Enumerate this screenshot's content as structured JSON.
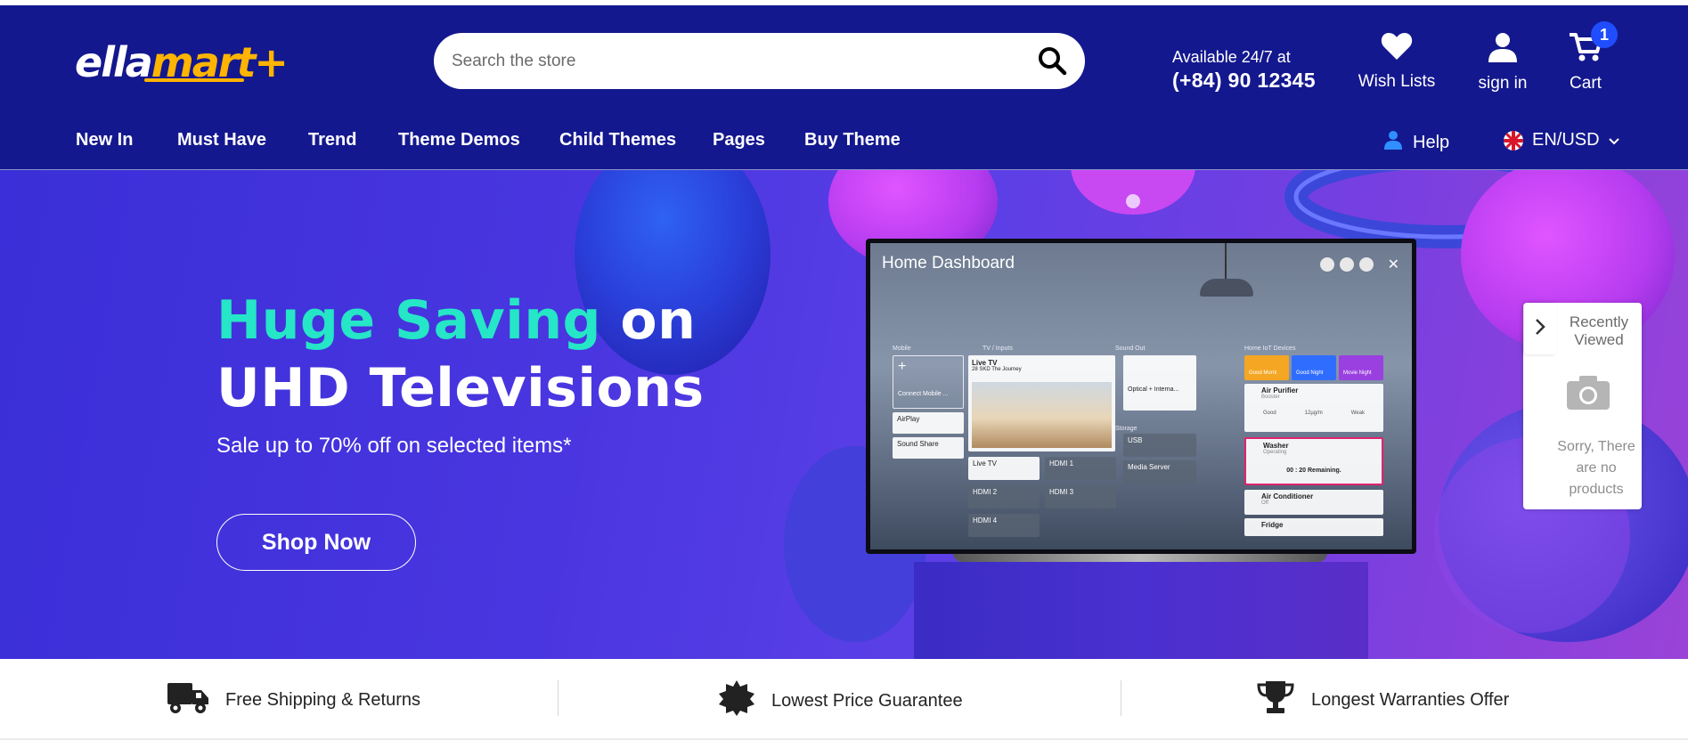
{
  "brand": {
    "logo_main": "ella",
    "logo_accent": "mart+",
    "accent_color": "#ffb400",
    "header_bg": "#14188e"
  },
  "search": {
    "placeholder": "Search the store",
    "icon": "search-icon"
  },
  "support": {
    "line1": "Available 24/7 at",
    "phone": "(+84) 90 12345"
  },
  "actions": {
    "wishlist": {
      "label": "Wish Lists",
      "icon": "heart-icon"
    },
    "signin": {
      "label": "sign in",
      "icon": "user-icon"
    },
    "cart": {
      "label": "Cart",
      "icon": "cart-icon",
      "count": "1"
    }
  },
  "nav": {
    "items": [
      "New In",
      "Must Have",
      "Trend",
      "Theme Demos",
      "Child Themes",
      "Pages",
      "Buy Theme"
    ],
    "help": "Help",
    "lang": "EN/USD"
  },
  "hero": {
    "title_highlight": "Huge Saving",
    "title_rest1": " on",
    "title_line2": "UHD Televisions",
    "subtitle": "Sale up to 70% off on selected items*",
    "cta": "Shop Now",
    "highlight_color": "#25e6c6"
  },
  "tv": {
    "dashboard_title": "Home Dashboard",
    "sections": {
      "mobile": "Mobile",
      "tv_inputs": "TV / Inputs",
      "sound_out": "Sound Out",
      "home_iot": "Home IoT Devices",
      "storage": "Storage"
    },
    "tiles": {
      "connect_mobile": "Connect Mobile ...",
      "airplay": "AirPlay",
      "sound_share": "Sound Share",
      "live_tv": "Live TV",
      "channel": "28 SKD",
      "program": "The Journey",
      "live_tv_2": "Live TV",
      "hdmi1": "HDMI 1",
      "hdmi2": "HDMI 2",
      "hdmi3": "HDMI 3",
      "hdmi4": "HDMI 4",
      "optical": "Optical + Interna...",
      "usb": "USB",
      "media_server": "Media Server",
      "good_morning": "Good Morni",
      "good_night": "Good Night",
      "movie_night": "Movie Night",
      "air_purifier": "Air Purifier",
      "air_purifier_status": "Booster",
      "aq_good": "Good",
      "aq_value": "12µg/m",
      "aq_weak": "Weak",
      "washer": "Washer",
      "washer_status": "Operating",
      "washer_time": "00 : 20 Remaining.",
      "air_conditioner": "Air Conditioner",
      "ac_status": "Off",
      "fridge": "Fridge"
    }
  },
  "recently_viewed": {
    "title": "Recently Viewed",
    "empty": "Sorry, There are no products"
  },
  "features": [
    {
      "label": "Free Shipping & Returns",
      "icon": "truck-icon"
    },
    {
      "label": "Lowest Price Guarantee",
      "icon": "badge-icon"
    },
    {
      "label": "Longest Warranties Offer",
      "icon": "trophy-icon"
    }
  ]
}
